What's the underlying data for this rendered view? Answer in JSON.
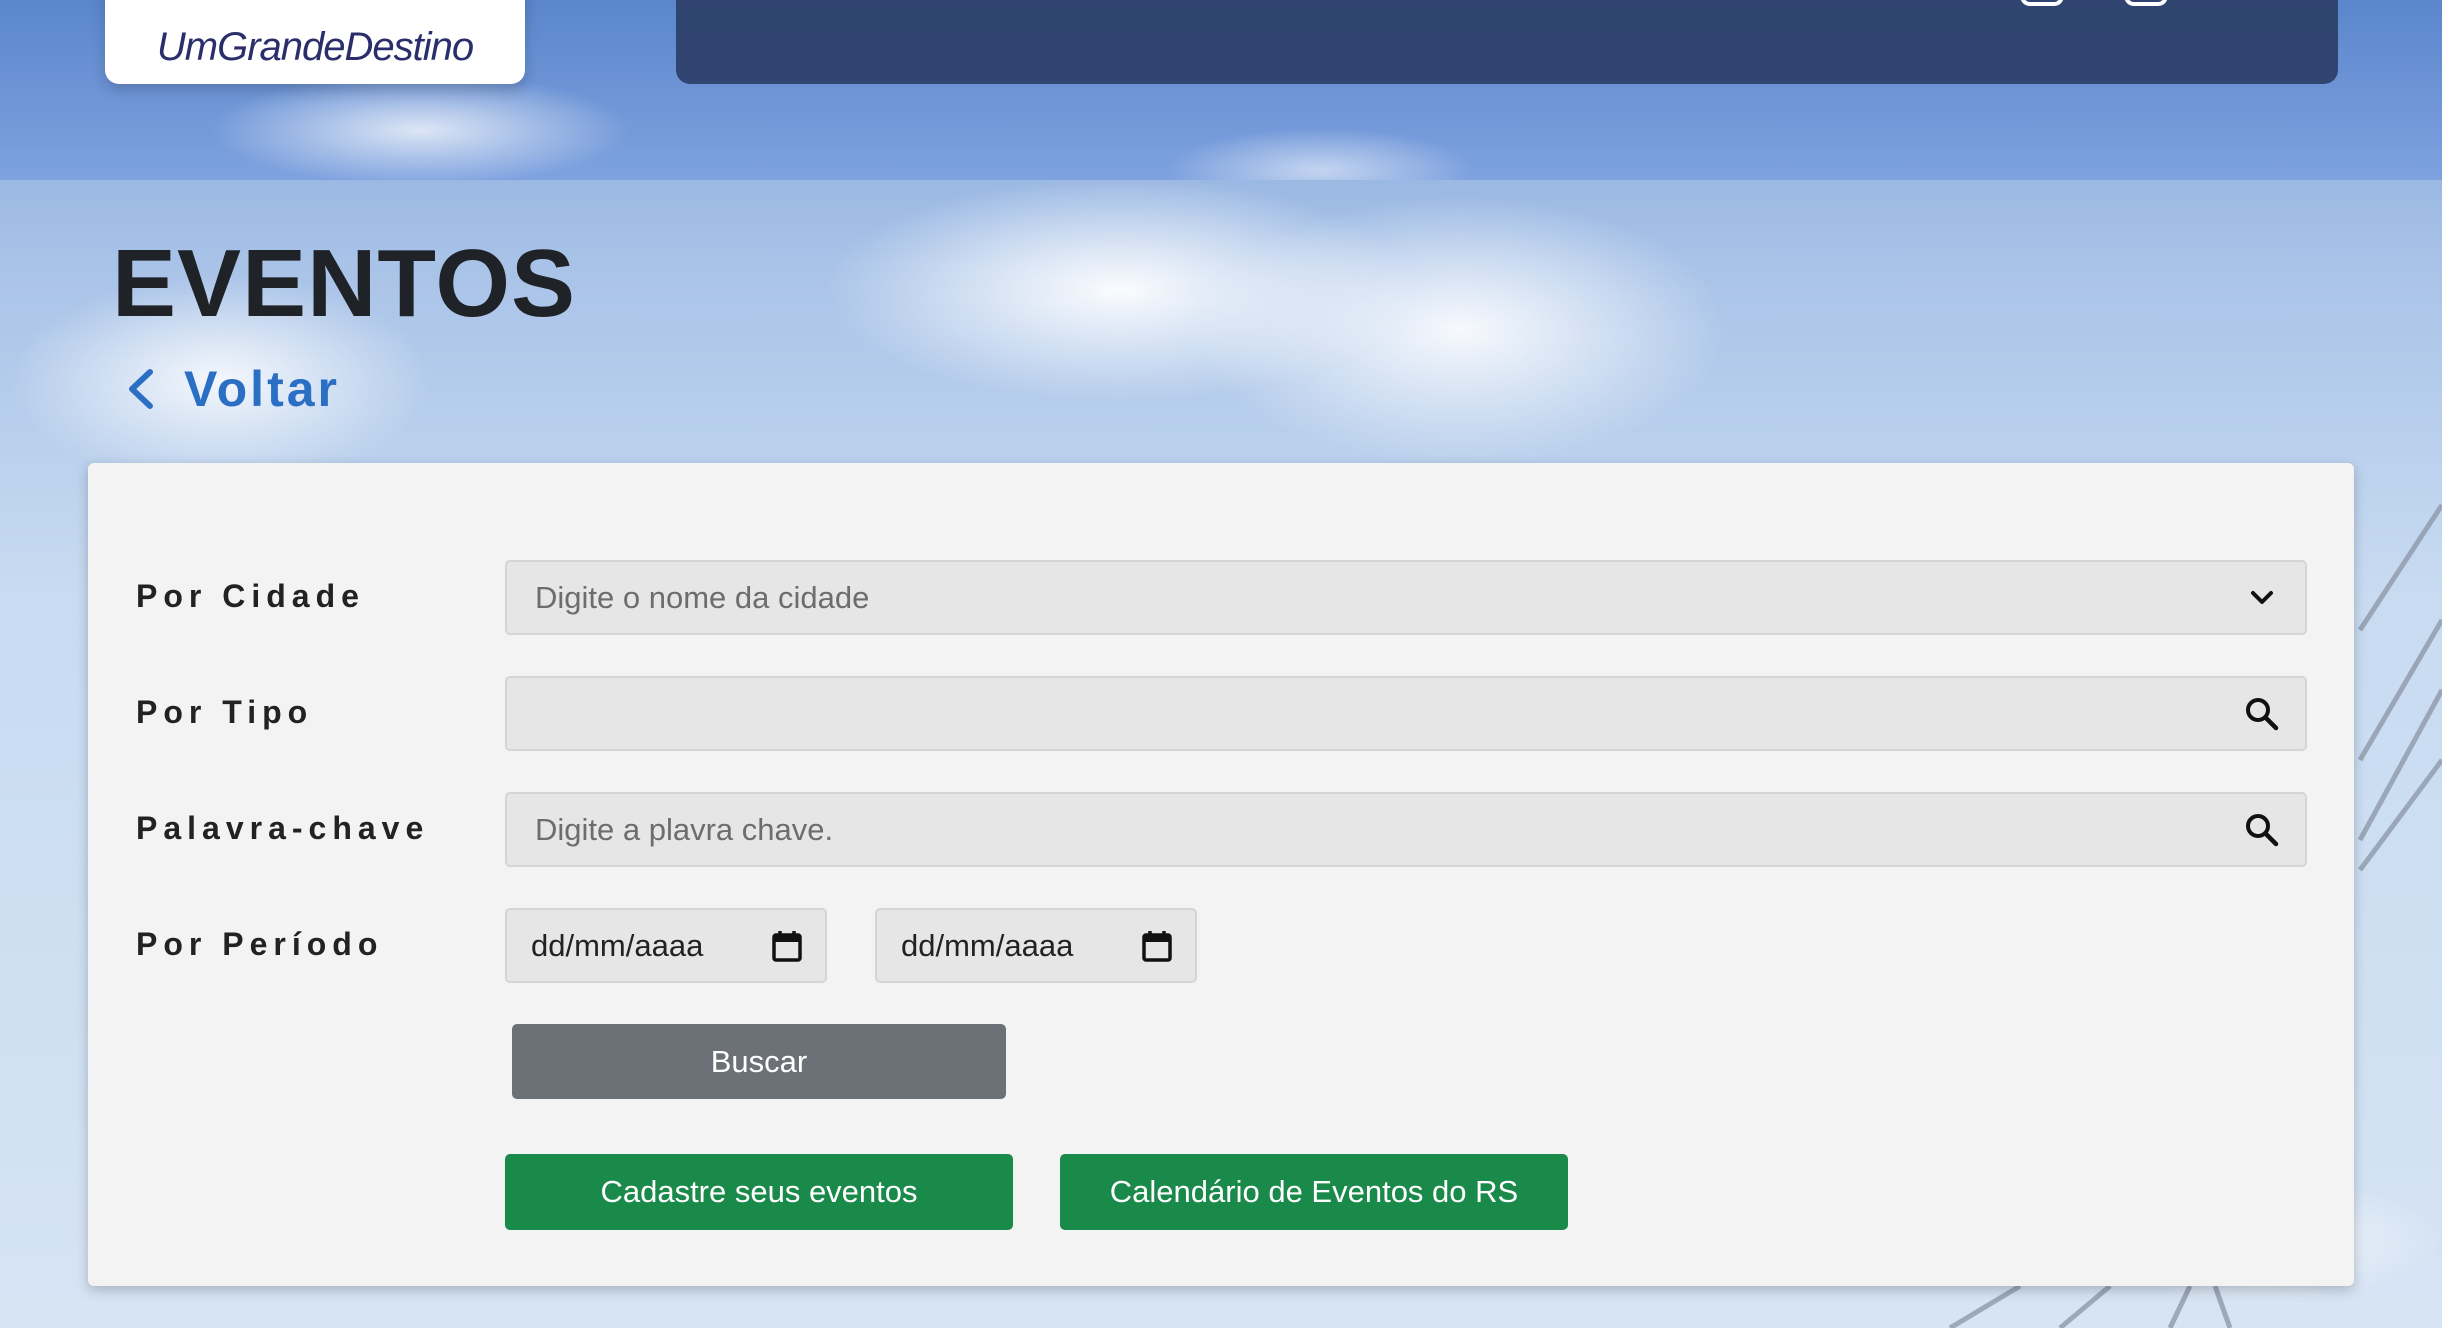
{
  "header": {
    "logo_text": "UmGrandeDestino"
  },
  "page": {
    "title": "EVENTOS",
    "back_label": "Voltar"
  },
  "filters": {
    "city": {
      "label": "Por Cidade",
      "placeholder": "Digite o nome da cidade",
      "value": ""
    },
    "type": {
      "label": "Por Tipo",
      "placeholder": "",
      "value": ""
    },
    "keyword": {
      "label": "Palavra-chave",
      "placeholder": "Digite a plavra chave.",
      "value": ""
    },
    "period": {
      "label": "Por Período",
      "start": "dd/mm/aaaa",
      "end": "dd/mm/aaaa"
    }
  },
  "actions": {
    "search_label": "Buscar",
    "register_label": "Cadastre seus eventos",
    "calendar_label": "Calendário de Eventos do RS"
  },
  "colors": {
    "accent_link": "#2b6fc4",
    "search_button": "#6c7178",
    "primary_green": "#1a8a4a",
    "nav_bar": "#2c3e68"
  },
  "icons": {
    "back": "chevron-left-icon",
    "city_dropdown": "chevron-down-icon",
    "type_search": "search-icon",
    "keyword_search": "search-icon",
    "calendar": "calendar-icon"
  }
}
